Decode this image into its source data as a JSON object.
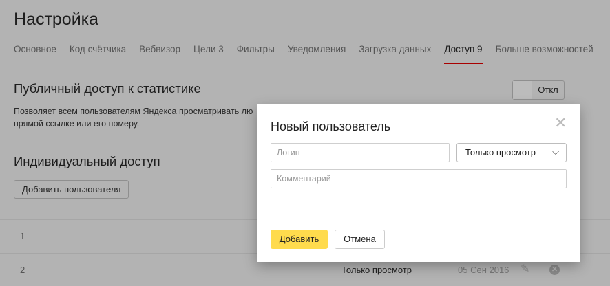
{
  "page": {
    "title": "Настройка"
  },
  "tabs": [
    {
      "label": "Основное"
    },
    {
      "label": "Код счётчика"
    },
    {
      "label": "Вебвизор"
    },
    {
      "label": "Цели 3"
    },
    {
      "label": "Фильтры"
    },
    {
      "label": "Уведомления"
    },
    {
      "label": "Загрузка данных"
    },
    {
      "label": "Доступ 9",
      "active": true
    },
    {
      "label": "Больше возможностей"
    }
  ],
  "public_access": {
    "heading": "Публичный доступ к статистике",
    "description_line1": "Позволяет всем пользователям Яндекса просматривать лю",
    "description_line2": "прямой ссылке или его номеру.",
    "toggle_label": "Откл"
  },
  "individual_access": {
    "heading": "Индивидуальный доступ",
    "add_user_label": "Добавить пользователя",
    "rows": [
      {
        "num": "1"
      },
      {
        "num": "2",
        "access": "Только просмотр",
        "date": "05 Сен 2016"
      }
    ]
  },
  "modal": {
    "title": "Новый пользователь",
    "login_placeholder": "Логин",
    "access_select": "Только просмотр",
    "comment_placeholder": "Комментарий",
    "add_label": "Добавить",
    "cancel_label": "Отмена"
  },
  "colors": {
    "accent": "#ffdb4d",
    "active_tab": "#a80000"
  }
}
